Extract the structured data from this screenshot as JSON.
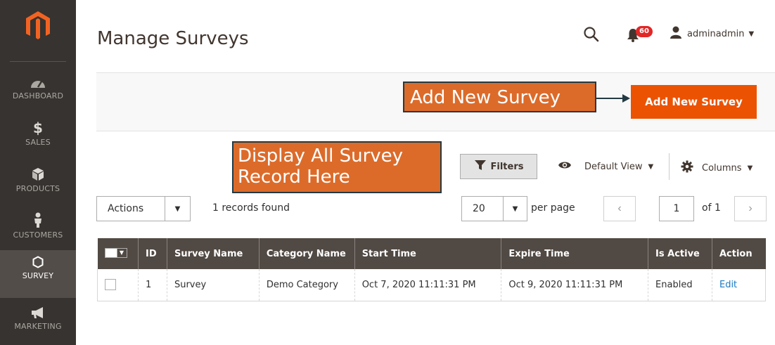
{
  "sidebar": {
    "logo": "magento-logo",
    "items": [
      {
        "label": "DASHBOARD",
        "icon": "speedometer-icon"
      },
      {
        "label": "SALES",
        "icon": "dollar-icon"
      },
      {
        "label": "PRODUCTS",
        "icon": "cube-icon"
      },
      {
        "label": "CUSTOMERS",
        "icon": "person-icon"
      },
      {
        "label": "SURVEY",
        "icon": "hexagon-icon",
        "active": true
      },
      {
        "label": "MARKETING",
        "icon": "megaphone-icon"
      }
    ]
  },
  "header": {
    "title": "Manage Surveys",
    "notification_count": "60",
    "user_name": "adminadmin"
  },
  "action_bar": {
    "add_button_label": "Add New Survey"
  },
  "callouts": {
    "add_new": "Add New Survey",
    "display_all": "Display All Survey Record Here"
  },
  "toolbar": {
    "filters_label": "Filters",
    "view_label": "Default View",
    "columns_label": "Columns",
    "actions_label": "Actions",
    "records_found": "1 records found",
    "per_page_value": "20",
    "per_page_label": "per page",
    "page_current": "1",
    "page_of": "of 1"
  },
  "table": {
    "columns": [
      "ID",
      "Survey Name",
      "Category Name",
      "Start Time",
      "Expire Time",
      "Is Active",
      "Action"
    ],
    "rows": [
      {
        "id": "1",
        "survey_name": "Survey",
        "category_name": "Demo Category",
        "start_time": "Oct 7, 2020 11:11:31 PM",
        "expire_time": "Oct 9, 2020 11:11:31 PM",
        "is_active": "Enabled",
        "action": "Edit"
      }
    ]
  },
  "colors": {
    "sidebar_bg": "#373330",
    "accent": "#eb5202",
    "table_header": "#514943",
    "callout": "#dc6b2a",
    "link": "#1979c3"
  }
}
